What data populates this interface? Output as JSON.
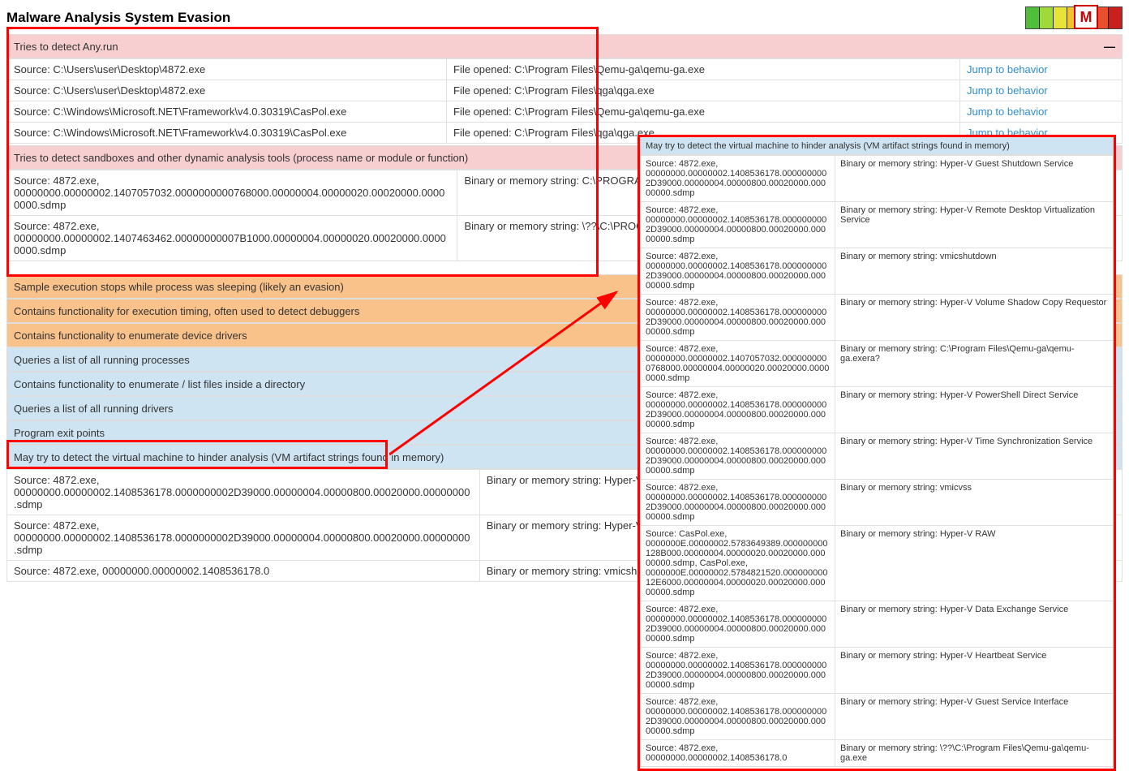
{
  "title": "Malware Analysis System Evasion",
  "jump_label": "Jump to behavior",
  "sections": {
    "anyrun": {
      "title": "Tries to detect Any.run",
      "rows": [
        {
          "source": "Source: C:\\Users\\user\\Desktop\\4872.exe",
          "detail": "File opened: C:\\Program Files\\Qemu-ga\\qemu-ga.exe"
        },
        {
          "source": "Source: C:\\Users\\user\\Desktop\\4872.exe",
          "detail": "File opened: C:\\Program Files\\qga\\qga.exe"
        },
        {
          "source": "Source: C:\\Windows\\Microsoft.NET\\Framework\\v4.0.30319\\CasPol.exe",
          "detail": "File opened: C:\\Program Files\\Qemu-ga\\qemu-ga.exe"
        },
        {
          "source": "Source: C:\\Windows\\Microsoft.NET\\Framework\\v4.0.30319\\CasPol.exe",
          "detail": "File opened: C:\\Program Files\\qga\\qga.exe"
        }
      ]
    },
    "sandbox": {
      "title": "Tries to detect sandboxes and other dynamic analysis tools (process name or module or function)",
      "rows": [
        {
          "source": "Source: 4872.exe, 00000000.00000002.1407057032.0000000000768000.00000004.00000020.00020000.00000000.sdmp",
          "detail": "Binary or memory string: C:\\PROGRAM FILES\\QEMU-GA\\QEMU-GA.EXERA?"
        },
        {
          "source": "Source: 4872.exe, 00000000.00000002.1407463462.00000000007B1000.00000004.00000020.00020000.00000000.sdmp",
          "detail": "Binary or memory string: \\??\\C:\\PROGRAM FILES\\QEMU-GA\\QEMU-GA.EXE"
        }
      ]
    },
    "orange_items": [
      "Sample execution stops while process was sleeping (likely an evasion)",
      "Contains functionality for execution timing, often used to detect debuggers",
      "Contains functionality to enumerate device drivers"
    ],
    "blue_items": [
      "Queries a list of all running processes",
      "Contains functionality to enumerate / list files inside a directory",
      "Queries a list of all running drivers",
      "Program exit points"
    ],
    "vm_detect": {
      "title": "May try to detect the virtual machine to hinder analysis (VM artifact strings found in memory)",
      "rows": [
        {
          "source": "Source: 4872.exe, 00000000.00000002.1408536178.0000000002D39000.00000004.00000800.00020000.00000000.sdmp",
          "detail": "Binary or memory string: Hyper-V Guest Shutdown Service"
        },
        {
          "source": "Source: 4872.exe, 00000000.00000002.1408536178.0000000002D39000.00000004.00000800.00020000.00000000.sdmp",
          "detail": "Binary or memory string: Hyper-V Remote Desktop Virtualization Service"
        },
        {
          "source": "Source: 4872.exe, 00000000.00000002.1408536178.0",
          "detail": "Binary or memory string: vmicshutdown"
        }
      ]
    }
  },
  "float_panel": {
    "title": "May try to detect the virtual machine to hinder analysis (VM artifact strings found in memory)",
    "rows": [
      {
        "source": "Source: 4872.exe, 00000000.00000002.1408536178.0000000002D39000.00000004.00000800.00020000.00000000.sdmp",
        "detail": "Binary or memory string: Hyper-V Guest Shutdown Service"
      },
      {
        "source": "Source: 4872.exe, 00000000.00000002.1408536178.0000000002D39000.00000004.00000800.00020000.00000000.sdmp",
        "detail": "Binary or memory string: Hyper-V Remote Desktop Virtualization Service"
      },
      {
        "source": "Source: 4872.exe, 00000000.00000002.1408536178.0000000002D39000.00000004.00000800.00020000.00000000.sdmp",
        "detail": "Binary or memory string: vmicshutdown"
      },
      {
        "source": "Source: 4872.exe, 00000000.00000002.1408536178.0000000002D39000.00000004.00000800.00020000.00000000.sdmp",
        "detail": "Binary or memory string: Hyper-V Volume Shadow Copy Requestor"
      },
      {
        "source": "Source: 4872.exe, 00000000.00000002.1407057032.0000000000768000.00000004.00000020.00020000.00000000.sdmp",
        "detail": "Binary or memory string: C:\\Program Files\\Qemu-ga\\qemu-ga.exera?"
      },
      {
        "source": "Source: 4872.exe, 00000000.00000002.1408536178.0000000002D39000.00000004.00000800.00020000.00000000.sdmp",
        "detail": "Binary or memory string: Hyper-V PowerShell Direct Service"
      },
      {
        "source": "Source: 4872.exe, 00000000.00000002.1408536178.0000000002D39000.00000004.00000800.00020000.00000000.sdmp",
        "detail": "Binary or memory string: Hyper-V Time Synchronization Service"
      },
      {
        "source": "Source: 4872.exe, 00000000.00000002.1408536178.0000000002D39000.00000004.00000800.00020000.00000000.sdmp",
        "detail": "Binary or memory string: vmicvss"
      },
      {
        "source": "Source: CasPol.exe, 0000000E.00000002.5783649389.000000000128B000.00000004.00000020.00020000.00000000.sdmp, CasPol.exe, 0000000E.00000002.5784821520.00000000012E6000.00000004.00000020.00020000.00000000.sdmp",
        "detail": "Binary or memory string: Hyper-V RAW"
      },
      {
        "source": "Source: 4872.exe, 00000000.00000002.1408536178.0000000002D39000.00000004.00000800.00020000.00000000.sdmp",
        "detail": "Binary or memory string: Hyper-V Data Exchange Service"
      },
      {
        "source": "Source: 4872.exe, 00000000.00000002.1408536178.0000000002D39000.00000004.00000800.00020000.00000000.sdmp",
        "detail": "Binary or memory string: Hyper-V Heartbeat Service"
      },
      {
        "source": "Source: 4872.exe, 00000000.00000002.1408536178.0000000002D39000.00000004.00000800.00020000.00000000.sdmp",
        "detail": "Binary or memory string: Hyper-V Guest Service Interface"
      },
      {
        "source": "Source: 4872.exe, 00000000.00000002.1408536178.0",
        "detail": "Binary or memory string: \\??\\C:\\Program Files\\Qemu-ga\\qemu-ga.exe"
      }
    ]
  },
  "severity_colors": [
    "#4fbf3a",
    "#9fd93a",
    "#e7e337",
    "#f3c233",
    "#f08a2c",
    "#e84f2c",
    "#c9201e"
  ]
}
